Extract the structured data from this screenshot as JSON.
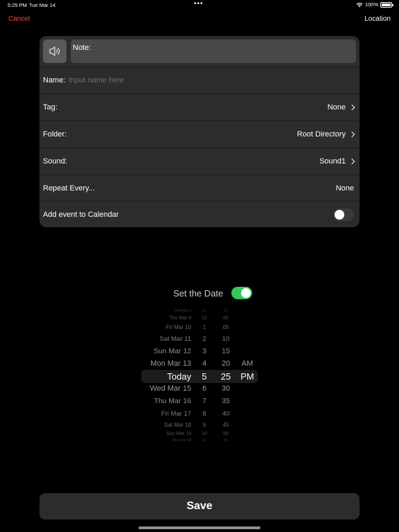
{
  "status_bar": {
    "time": "5:25 PM",
    "date": "Tue Mar 14",
    "dots": "•••",
    "battery": "100%"
  },
  "nav": {
    "cancel_label": "Cancel",
    "location_label": "Location"
  },
  "form": {
    "note_label": "Note:",
    "name_label": "Name:",
    "name_placeholder": "Input name here",
    "tag_label": "Tag:",
    "tag_value": "None",
    "folder_label": "Folder:",
    "folder_value": "Root Directory",
    "sound_label": "Sound:",
    "sound_value": "Sound1",
    "repeat_label": "Repeat Every...",
    "repeat_value": "None",
    "calendar_label": "Add event to Calendar",
    "calendar_toggle_on": false
  },
  "set_date": {
    "label": "Set the Date",
    "toggle_on": true
  },
  "picker": {
    "rows": [
      {
        "date": "Wed Mar 8",
        "hour": "11",
        "minute": "55",
        "ampm": ""
      },
      {
        "date": "Thu Mar 9",
        "hour": "12",
        "minute": "00",
        "ampm": ""
      },
      {
        "date": "Fri Mar 10",
        "hour": "1",
        "minute": "05",
        "ampm": ""
      },
      {
        "date": "Sat Mar 11",
        "hour": "2",
        "minute": "10",
        "ampm": ""
      },
      {
        "date": "Sun Mar 12",
        "hour": "3",
        "minute": "15",
        "ampm": ""
      },
      {
        "date": "Mon Mar 13",
        "hour": "4",
        "minute": "20",
        "ampm": "AM"
      },
      {
        "date": "Today",
        "hour": "5",
        "minute": "25",
        "ampm": "PM"
      },
      {
        "date": "Wed Mar 15",
        "hour": "6",
        "minute": "30",
        "ampm": ""
      },
      {
        "date": "Thu Mar 16",
        "hour": "7",
        "minute": "35",
        "ampm": ""
      },
      {
        "date": "Fri Mar 17",
        "hour": "8",
        "minute": "40",
        "ampm": ""
      },
      {
        "date": "Sat Mar 18",
        "hour": "9",
        "minute": "45",
        "ampm": ""
      },
      {
        "date": "Sun Mar 19",
        "hour": "10",
        "minute": "50",
        "ampm": ""
      },
      {
        "date": "Mon Mar 20",
        "hour": "11",
        "minute": "55",
        "ampm": ""
      }
    ],
    "selected_index": 6
  },
  "save_label": "Save"
}
